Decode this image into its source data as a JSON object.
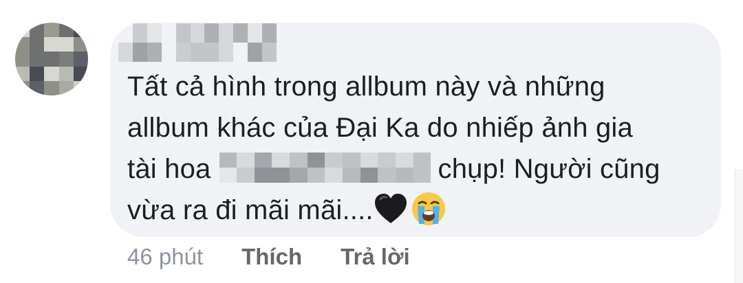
{
  "comment": {
    "lines": [
      "Tất cả hình trong allbum này và những",
      "allbum khác của Đại Ka do nhiếp ảnh gia",
      "tài hoa",
      "chụp! Người cũng",
      "vừa ra đi mãi mãi...."
    ],
    "icons": [
      "black-heart-icon",
      "loudly-crying-face-icon"
    ]
  },
  "actions": {
    "timestamp": "46 phút",
    "like_label": "Thích",
    "reply_label": "Trả lời"
  },
  "colors": {
    "bubble_background": "#f0f2f5",
    "text": "#1c1e21",
    "action_text": "#65676b",
    "timestamp_text": "#8d949e"
  }
}
